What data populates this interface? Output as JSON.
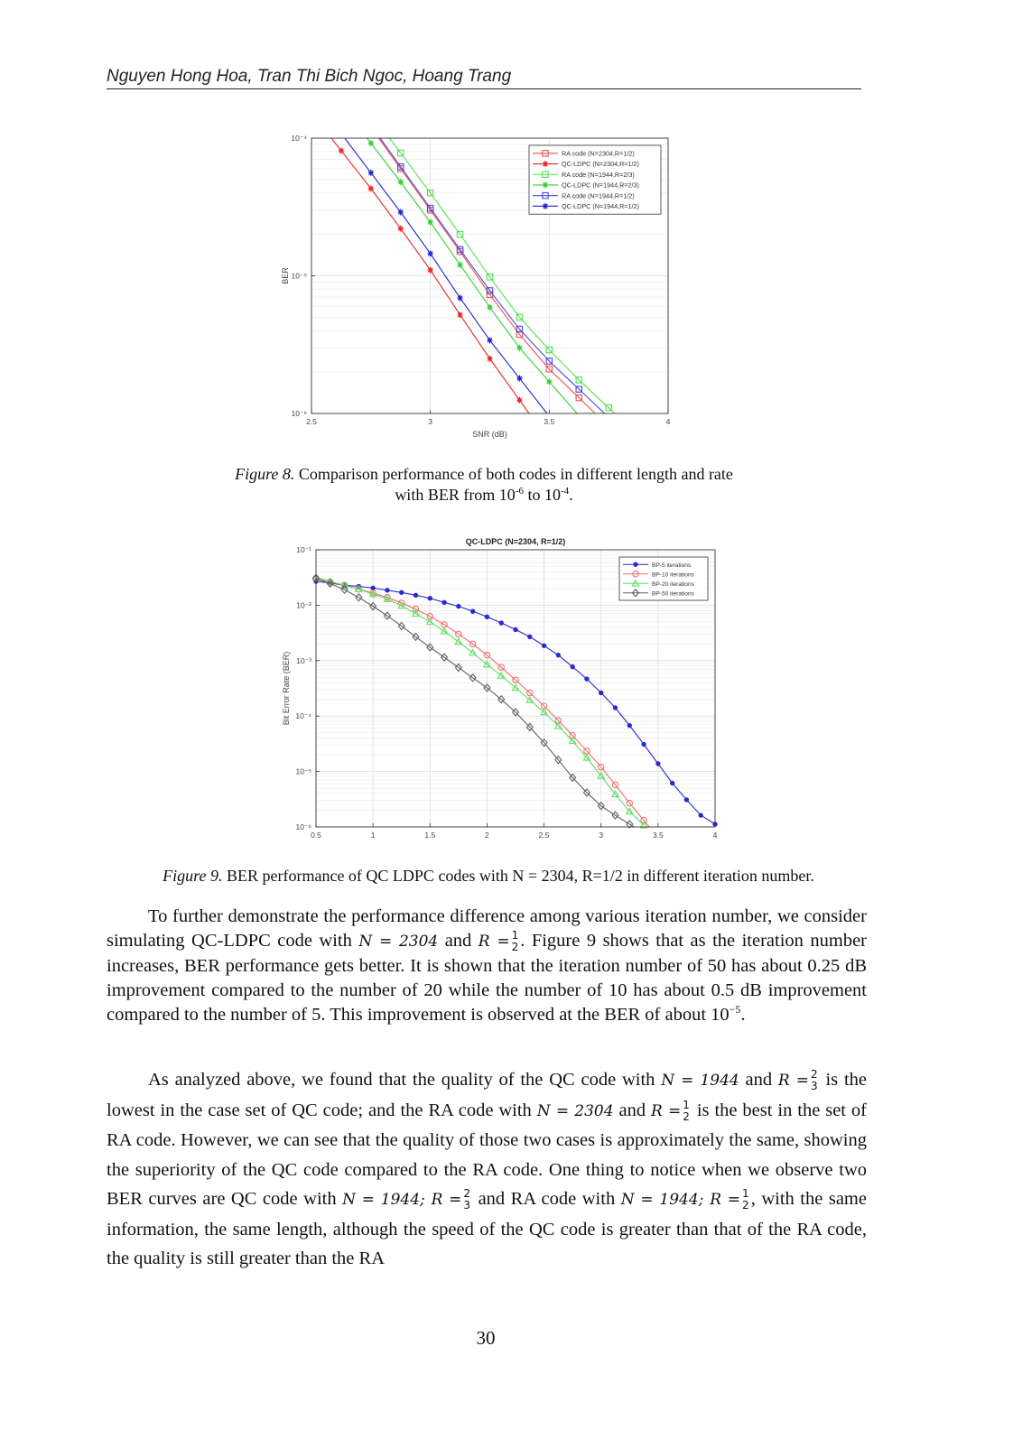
{
  "header": {
    "authors": "Nguyen Hong Hoa, Tran Thi Bich Ngoc, Hoang Trang"
  },
  "figure8": {
    "caption_label": "Figure 8.",
    "caption_line1": " Comparison performance of both codes in different length and rate",
    "caption_line2_pre": "with BER from 10",
    "caption_exp1": "-6",
    "caption_mid": " to 10",
    "caption_exp2": "-4",
    "caption_end": "."
  },
  "figure9": {
    "caption_label": "Figure 9.",
    "caption_text": " BER performance of QC LDPC codes with N = 2304, R=1/2 in different iteration number."
  },
  "paragraphs": {
    "p1": {
      "a": "To further demonstrate the performance difference among various iteration number, we consider simulating QC-LDPC code with ",
      "m1": "N = 2304",
      "b": " and ",
      "m2": "R =",
      "f_num": "1",
      "f_den": "2",
      "c": ". Figure 9 shows that as the iteration number increases, BER performance gets better. It is shown that the iteration number of 50 has about 0.25 dB improvement compared to the number of 20 while the number of 10 has about 0.5 dB improvement compared to the number of 5. This improvement is observed at the BER of about 10",
      "exp": "−5",
      "d": "."
    },
    "p2": {
      "a": "As analyzed above, we found that the quality of the QC code with ",
      "m1": "N = 1944",
      "b": " and ",
      "m2": "R =",
      "f1_num": "2",
      "f1_den": "3",
      "c": " is the lowest in the case set of QC code; and the RA code with ",
      "m3": "N = 2304",
      "d": " and ",
      "m4": "R =",
      "f2_num": "1",
      "f2_den": "2",
      "e": " is the best in the set of RA code. However, we can see that the quality of those two cases is approximately the same, showing the superiority of the QC code compared to the RA code. One thing to notice when we observe two BER curves are QC code with ",
      "m5": "N = 1944; R =",
      "f3_num": "2",
      "f3_den": "3",
      "f": " and RA code with ",
      "m6": "N = 1944; R =",
      "f4_num": "1",
      "f4_den": "2",
      "g": ", with the same information, the same length, although the speed of the QC code is greater than that of the RA code, the quality is still greater than the RA"
    }
  },
  "page_number": "30",
  "chart_data": [
    {
      "type": "line",
      "title": "",
      "xlabel": "SNR (dB)",
      "ylabel": "BER",
      "xlim": [
        2.5,
        4
      ],
      "ylim": [
        1e-06,
        0.0001
      ],
      "yscale": "log",
      "grid": true,
      "legend_position": "top-right",
      "xticks": [
        2.5,
        3,
        3.5,
        4
      ],
      "xtick_labels": [
        "2.5",
        "3",
        "3.5",
        "4"
      ],
      "yticks": [
        1e-06,
        1e-05,
        0.0001
      ],
      "ytick_labels": [
        "10⁻⁶",
        "10⁻⁵",
        "10⁻⁴"
      ],
      "series": [
        {
          "name": "RA code   (N=2304,R=1/2)",
          "color": "#f05050",
          "marker": "square",
          "x": [
            2.875,
            3.0,
            3.125,
            3.25,
            3.375,
            3.5,
            3.625
          ],
          "y": [
            6e-05,
            3e-05,
            1.5e-05,
            7.3e-06,
            3.75e-06,
            2.1e-06,
            1.3e-06
          ]
        },
        {
          "name": "QC-LDPC (N=2304,R=1/2)",
          "color": "#f02020",
          "marker": "star",
          "x": [
            2.625,
            2.75,
            2.875,
            3.0,
            3.125,
            3.25,
            3.375
          ],
          "y": [
            8.1e-05,
            4.3e-05,
            2.2e-05,
            1.1e-05,
            5.2e-06,
            2.5e-06,
            1.25e-06
          ]
        },
        {
          "name": "RA code   (N=1944,R=2/3)",
          "color": "#50e050",
          "marker": "square",
          "x": [
            2.875,
            3.0,
            3.125,
            3.25,
            3.375,
            3.5,
            3.625,
            3.75
          ],
          "y": [
            7.8e-05,
            4e-05,
            2e-05,
            9.8e-06,
            5e-06,
            2.9e-06,
            1.75e-06,
            1.1e-06
          ]
        },
        {
          "name": "QC-LDPC (N=1944,R=2/3)",
          "color": "#30d030",
          "marker": "star",
          "x": [
            2.75,
            2.875,
            3.0,
            3.125,
            3.25,
            3.375,
            3.5
          ],
          "y": [
            9.2e-05,
            4.8e-05,
            2.45e-05,
            1.2e-05,
            5.9e-06,
            3e-06,
            1.7e-06
          ]
        },
        {
          "name": "RA code   (N=1944,R=1/2)",
          "color": "#4a4ae0",
          "marker": "square",
          "x": [
            2.875,
            3.0,
            3.125,
            3.25,
            3.375,
            3.5,
            3.625
          ],
          "y": [
            6.2e-05,
            3.1e-05,
            1.55e-05,
            7.8e-06,
            4.1e-06,
            2.4e-06,
            1.5e-06
          ]
        },
        {
          "name": "QC-LDPC (N=1944,R=1/2)",
          "color": "#2020d0",
          "marker": "star",
          "x": [
            2.75,
            2.875,
            3.0,
            3.125,
            3.25,
            3.375
          ],
          "y": [
            5.6e-05,
            2.9e-05,
            1.45e-05,
            6.9e-06,
            3.4e-06,
            1.8e-06
          ]
        }
      ]
    },
    {
      "type": "line",
      "title": "QC-LDPC (N=2304, R=1/2)",
      "xlabel": "SNR (dB)",
      "ylabel": "Bit Error Rate (BER)",
      "xlim": [
        0.5,
        4
      ],
      "ylim": [
        1e-06,
        0.1
      ],
      "yscale": "log",
      "grid": true,
      "legend_position": "top-right",
      "xticks": [
        0.5,
        1,
        1.5,
        2,
        2.5,
        3,
        3.5,
        4
      ],
      "xtick_labels": [
        "0.5",
        "1",
        "1.5",
        "2",
        "2.5",
        "3",
        "3.5",
        "4"
      ],
      "yticks": [
        1e-06,
        1e-05,
        0.0001,
        0.001,
        0.01,
        0.1
      ],
      "ytick_labels": [
        "10⁻⁶",
        "10⁻⁵",
        "10⁻⁴",
        "10⁻³",
        "10⁻²",
        "10⁻¹"
      ],
      "series": [
        {
          "name": "BP-5 iterations",
          "color": "#2a2ad0",
          "marker": "dot",
          "x": [
            0.5,
            0.625,
            0.75,
            0.875,
            1.0,
            1.125,
            1.25,
            1.375,
            1.5,
            1.625,
            1.75,
            1.875,
            2.0,
            2.125,
            2.25,
            2.375,
            2.5,
            2.625,
            2.75,
            2.875,
            3.0,
            3.125,
            3.25,
            3.375,
            3.5,
            3.625,
            3.75,
            3.875,
            4.0
          ],
          "log10_y": [
            -1.57,
            -1.6,
            -1.64,
            -1.66,
            -1.69,
            -1.73,
            -1.77,
            -1.82,
            -1.875,
            -1.95,
            -2.02,
            -2.11,
            -2.21,
            -2.32,
            -2.44,
            -2.57,
            -2.73,
            -2.9,
            -3.11,
            -3.33,
            -3.58,
            -3.85,
            -4.17,
            -4.51,
            -4.86,
            -5.21,
            -5.51,
            -5.79,
            -5.95
          ]
        },
        {
          "name": "BP-10 iterations",
          "color": "#f07070",
          "marker": "circle",
          "x": [
            0.5,
            0.625,
            0.75,
            0.875,
            1.0,
            1.125,
            1.25,
            1.375,
            1.5,
            1.625,
            1.75,
            1.875,
            2.0,
            2.125,
            2.25,
            2.375,
            2.5,
            2.625,
            2.75,
            2.875,
            3.0,
            3.125,
            3.25,
            3.375
          ],
          "log10_y": [
            -1.51,
            -1.58,
            -1.64,
            -1.71,
            -1.78,
            -1.86,
            -1.96,
            -2.07,
            -2.2,
            -2.35,
            -2.52,
            -2.7,
            -2.9,
            -3.12,
            -3.35,
            -3.58,
            -3.82,
            -4.08,
            -4.35,
            -4.63,
            -4.92,
            -5.24,
            -5.57,
            -5.88
          ]
        },
        {
          "name": "BP-20 iterations",
          "color": "#60e060",
          "marker": "triangle",
          "x": [
            0.5,
            0.625,
            0.75,
            0.875,
            1.0,
            1.125,
            1.25,
            1.375,
            1.5,
            1.625,
            1.75,
            1.875,
            2.0,
            2.125,
            2.25,
            2.375,
            2.5,
            2.625,
            2.75,
            2.875,
            3.0,
            3.125,
            3.25,
            3.375
          ],
          "log10_y": [
            -1.5,
            -1.57,
            -1.64,
            -1.71,
            -1.8,
            -1.89,
            -2.01,
            -2.15,
            -2.3,
            -2.47,
            -2.66,
            -2.86,
            -3.07,
            -3.27,
            -3.49,
            -3.71,
            -3.93,
            -4.18,
            -4.45,
            -4.75,
            -5.08,
            -5.41,
            -5.72,
            -5.97
          ]
        },
        {
          "name": "BP-50 iterations",
          "color": "#606060",
          "marker": "diamond",
          "x": [
            0.5,
            0.625,
            0.75,
            0.875,
            1.0,
            1.125,
            1.25,
            1.375,
            1.5,
            1.625,
            1.75,
            1.875,
            2.0,
            2.125,
            2.25,
            2.375,
            2.5,
            2.625,
            2.75,
            2.875,
            3.0,
            3.125,
            3.25
          ],
          "log10_y": [
            -1.52,
            -1.61,
            -1.72,
            -1.86,
            -2.02,
            -2.19,
            -2.375,
            -2.57,
            -2.76,
            -2.94,
            -3.125,
            -3.31,
            -3.49,
            -3.7,
            -3.93,
            -4.2,
            -4.48,
            -4.79,
            -5.11,
            -5.38,
            -5.62,
            -5.79,
            -5.95
          ]
        }
      ]
    }
  ]
}
